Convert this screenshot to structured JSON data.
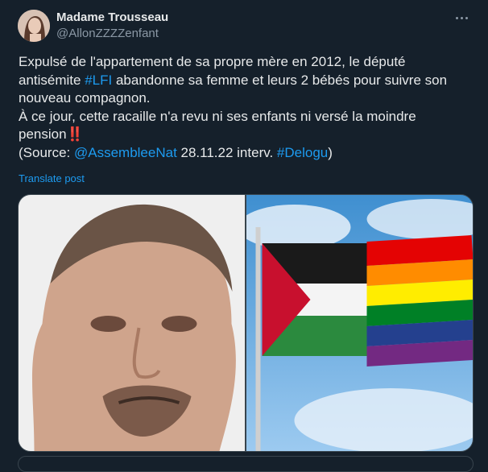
{
  "post": {
    "author": {
      "display_name": "Madame Trousseau",
      "handle": "@AllonZZZZenfant"
    },
    "text": {
      "line1": "Expulsé de l'appartement de sa propre mère en 2012, le député",
      "line2_before": "antisémite ",
      "hashtag_lfi": "#LFI",
      "line2_after": " abandonne sa femme et leurs 2 bébés pour suivre son",
      "line3": "nouveau compagnon.",
      "line4": "À ce jour, cette racaille n'a revu ni ses enfants ni versé la moindre",
      "line5": "pension",
      "emoji": "‼️",
      "source_open": "(Source: ",
      "mention": "@AssembleeNat",
      "source_middle": " 28.11.22 interv. ",
      "hashtag_delogu": "#Delogu",
      "source_close": ")"
    },
    "translate_label": "Translate post"
  },
  "colors": {
    "background": "#15202b",
    "text": "#e7e9ea",
    "muted": "#8b98a5",
    "link": "#1d9bf0",
    "border": "#38444d"
  }
}
